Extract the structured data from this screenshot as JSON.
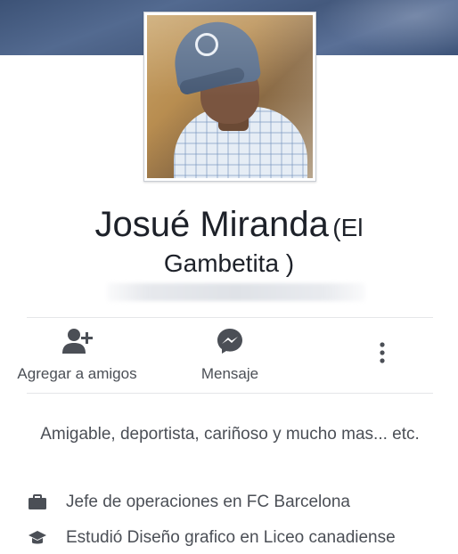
{
  "profile": {
    "name": "Josué Miranda",
    "nickname_part1": "(El",
    "nickname_part2": "Gambetita )"
  },
  "actions": {
    "add_friend_label": "Agregar a amigos",
    "message_label": "Mensaje"
  },
  "bio": "Amigable, deportista, cariñoso y mucho mas... etc.",
  "info": {
    "work": "Jefe de operaciones en FC Barcelona",
    "education": "Estudió Diseño grafico en Liceo canadiense"
  },
  "colors": {
    "icon": "#4b4f56",
    "cover": "#4a5f84"
  }
}
